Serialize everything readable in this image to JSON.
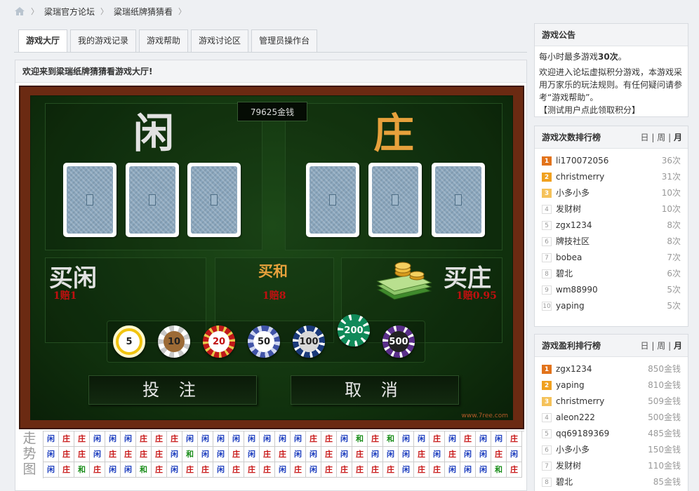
{
  "breadcrumb": [
    "粱瑞官方论坛",
    "粱瑞纸牌猜猜看"
  ],
  "tabs": [
    "游戏大厅",
    "我的游戏记录",
    "游戏帮助",
    "游戏讨论区",
    "管理员操作台"
  ],
  "hall": {
    "welcome": "欢迎来到粱瑞纸牌猜猜看游戏大厅!",
    "money": "79625金钱",
    "player_char": "闲",
    "banker_char": "庄",
    "bets": [
      {
        "label": "买闲",
        "odds": "1赔1"
      },
      {
        "label": "买和",
        "odds": "1赔8"
      },
      {
        "label": "买庄",
        "odds": "1赔0.95"
      }
    ],
    "chips": [
      "5",
      "10",
      "20",
      "50",
      "100",
      "200",
      "500"
    ],
    "bet_button": "投 注",
    "cancel_button": "取 消",
    "watermark": "www.7ree.com"
  },
  "trend": {
    "title": "走势图",
    "rows": [
      [
        "闲",
        "庄",
        "庄",
        "闲",
        "闲",
        "闲",
        "庄",
        "庄",
        "庄",
        "闲",
        "闲",
        "闲",
        "闲",
        "闲",
        "闲",
        "闲",
        "闲",
        "庄",
        "庄",
        "闲",
        "和",
        "庄",
        "和",
        "闲",
        "闲",
        "庄",
        "闲",
        "庄",
        "闲",
        "闲",
        "庄"
      ],
      [
        "闲",
        "庄",
        "庄",
        "闲",
        "庄",
        "庄",
        "庄",
        "庄",
        "闲",
        "和",
        "闲",
        "闲",
        "庄",
        "闲",
        "庄",
        "庄",
        "闲",
        "闲",
        "庄",
        "闲",
        "庄",
        "闲",
        "闲",
        "闲",
        "庄",
        "闲",
        "庄",
        "闲",
        "闲",
        "庄",
        "闲"
      ],
      [
        "闲",
        "庄",
        "和",
        "庄",
        "闲",
        "闲",
        "和",
        "庄",
        "闲",
        "庄",
        "庄",
        "闲",
        "庄",
        "庄",
        "庄",
        "闲",
        "庄",
        "闲",
        "庄",
        "庄",
        "庄",
        "庄",
        "庄",
        "闲",
        "庄",
        "庄",
        "闲",
        "闲",
        "闲",
        "和",
        "庄"
      ]
    ]
  },
  "notice": {
    "title": "游戏公告",
    "line1_prefix": "每小时最多游戏",
    "line1_bold": "30次",
    "line1_suffix": "。",
    "body": "欢迎进入论坛虚拟积分游戏，本游戏采用万家乐的玩法规则。有任何疑问请参考“游戏帮助”。",
    "link": "【测试用户点此领取积分】"
  },
  "periods": {
    "day": "日",
    "week": "周",
    "month": "月",
    "sep": "|"
  },
  "count_rank": {
    "title": "游戏次数排行榜",
    "items": [
      {
        "n": "1",
        "name": "li170072056",
        "val": "36次"
      },
      {
        "n": "2",
        "name": "christmerry",
        "val": "31次"
      },
      {
        "n": "3",
        "name": "小多小多",
        "val": "10次"
      },
      {
        "n": "4",
        "name": "发财树",
        "val": "10次"
      },
      {
        "n": "5",
        "name": "zgx1234",
        "val": "8次"
      },
      {
        "n": "6",
        "name": "牌技社区",
        "val": "8次"
      },
      {
        "n": "7",
        "name": "bobea",
        "val": "7次"
      },
      {
        "n": "8",
        "name": "碧北",
        "val": "6次"
      },
      {
        "n": "9",
        "name": "wm88990",
        "val": "5次"
      },
      {
        "n": "10",
        "name": "yaping",
        "val": "5次"
      }
    ]
  },
  "profit_rank": {
    "title": "游戏盈利排行榜",
    "items": [
      {
        "n": "1",
        "name": "zgx1234",
        "val": "850金钱"
      },
      {
        "n": "2",
        "name": "yaping",
        "val": "810金钱"
      },
      {
        "n": "3",
        "name": "christmerry",
        "val": "509金钱"
      },
      {
        "n": "4",
        "name": "aleon222",
        "val": "500金钱"
      },
      {
        "n": "5",
        "name": "qq69189369",
        "val": "485金钱"
      },
      {
        "n": "6",
        "name": "小多小多",
        "val": "150金钱"
      },
      {
        "n": "7",
        "name": "发财树",
        "val": "110金钱"
      },
      {
        "n": "8",
        "name": "碧北",
        "val": "85金钱"
      }
    ]
  }
}
